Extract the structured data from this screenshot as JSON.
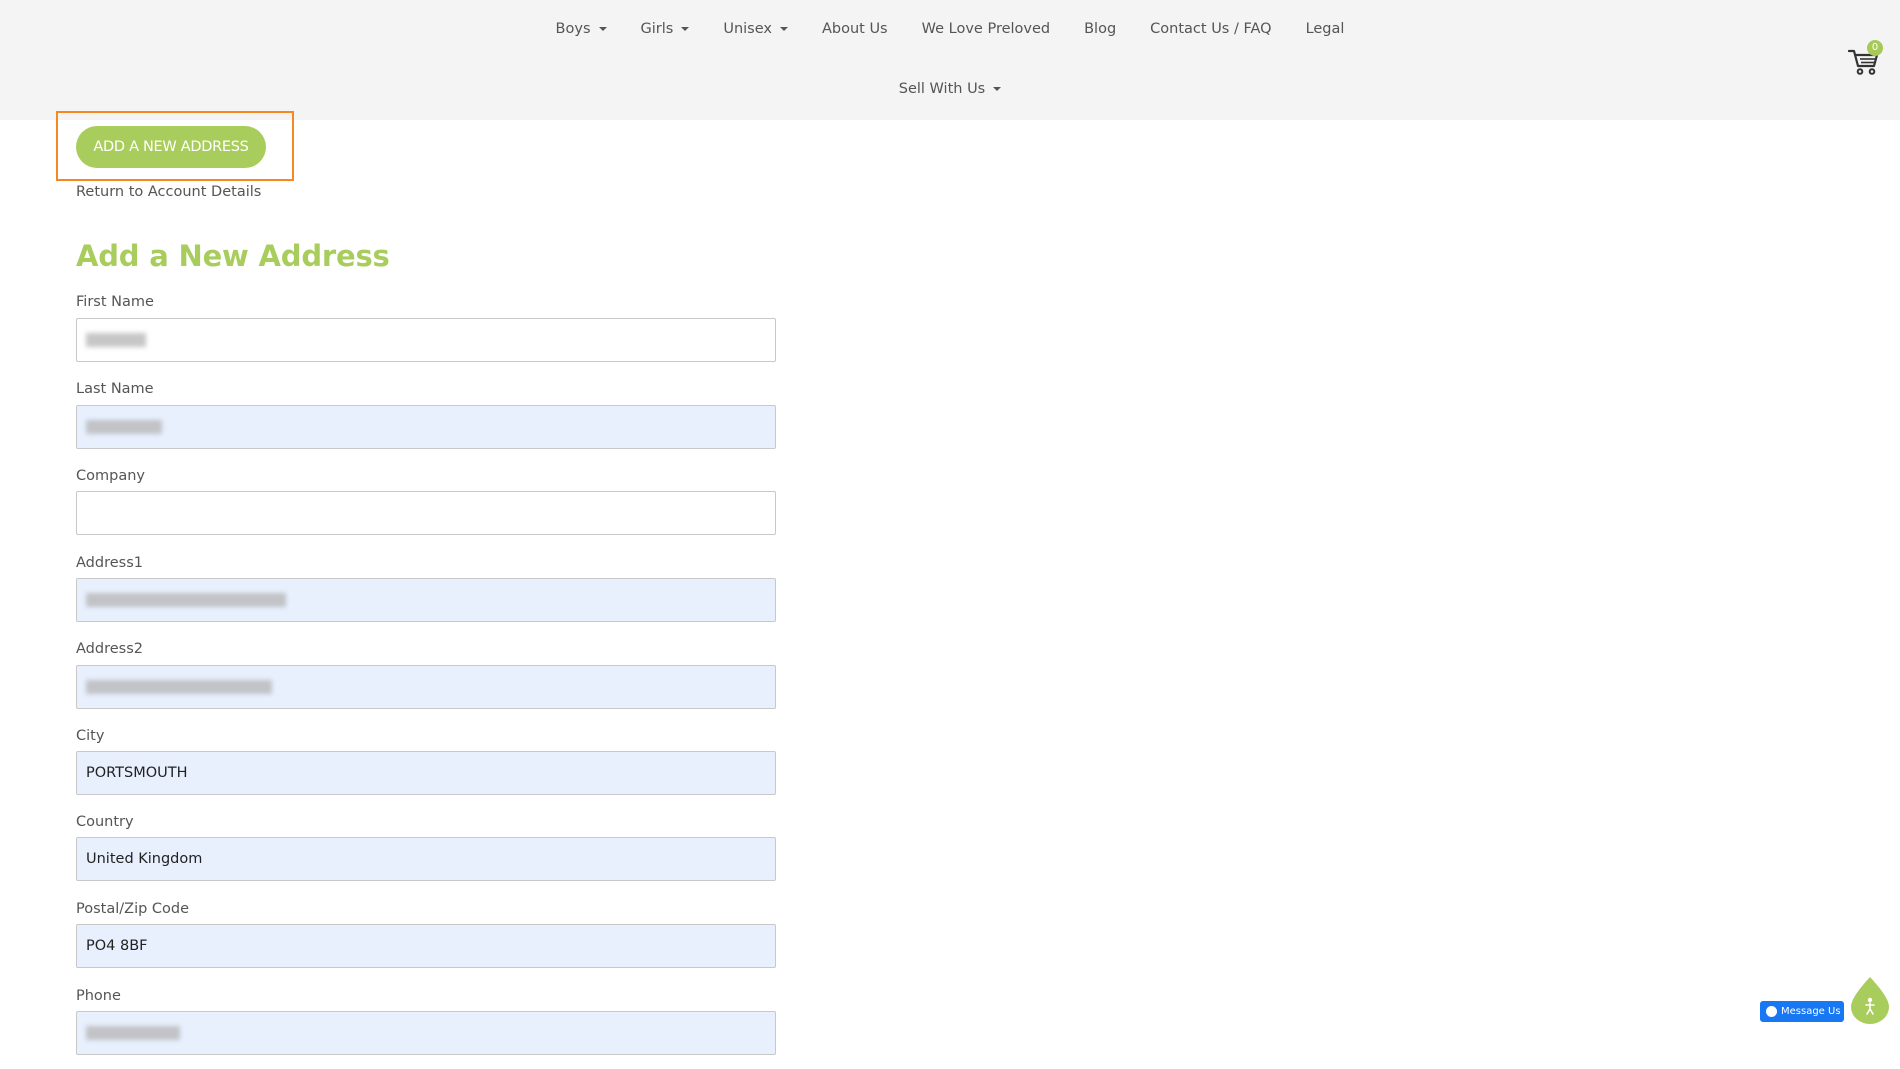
{
  "nav": {
    "row1": [
      {
        "label": "Boys",
        "dropdown": true
      },
      {
        "label": "Girls",
        "dropdown": true
      },
      {
        "label": "Unisex",
        "dropdown": true
      },
      {
        "label": "About Us",
        "dropdown": false
      },
      {
        "label": "We Love Preloved",
        "dropdown": false
      },
      {
        "label": "Blog",
        "dropdown": false
      },
      {
        "label": "Contact Us / FAQ",
        "dropdown": false
      },
      {
        "label": "Legal",
        "dropdown": false
      }
    ],
    "row2": [
      {
        "label": "Sell With Us",
        "dropdown": true
      }
    ],
    "cart_count": "0"
  },
  "main": {
    "add_button_label": "ADD A NEW ADDRESS",
    "return_link": "Return to Account Details",
    "page_title": "Add a New Address"
  },
  "form": {
    "first_name": {
      "label": "First Name",
      "value": ""
    },
    "last_name": {
      "label": "Last Name",
      "value": ""
    },
    "company": {
      "label": "Company",
      "value": ""
    },
    "address1": {
      "label": "Address1",
      "value": ""
    },
    "address2": {
      "label": "Address2",
      "value": ""
    },
    "city": {
      "label": "City",
      "value": "PORTSMOUTH"
    },
    "country": {
      "label": "Country",
      "value": "United Kingdom"
    },
    "postal": {
      "label": "Postal/Zip Code",
      "value": "PO4 8BF"
    },
    "phone": {
      "label": "Phone",
      "value": ""
    }
  },
  "widgets": {
    "messenger_label": "Message Us"
  },
  "colors": {
    "accent": "#a9cd5d",
    "highlight": "#f5891f",
    "autofill": "#e8f0fe",
    "header_bg": "#f4f4f4",
    "messenger": "#1877f2"
  }
}
